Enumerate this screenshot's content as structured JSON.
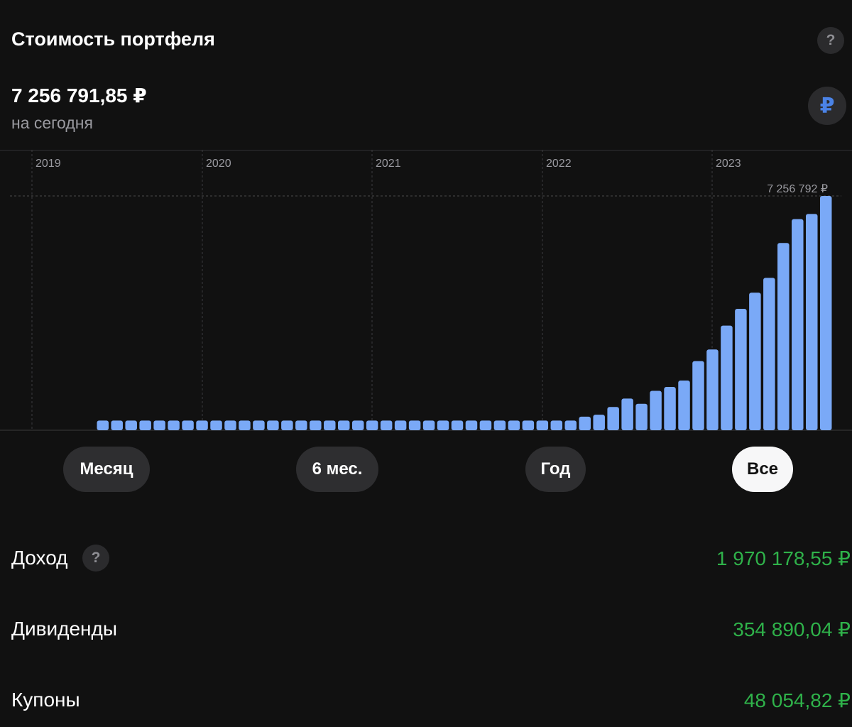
{
  "header": {
    "title": "Стоимость портфеля",
    "help_icon": "?"
  },
  "portfolio": {
    "value": "7 256 791,85  ₽",
    "subtitle": "на сегодня",
    "currency_icon": "₽"
  },
  "chart_data": {
    "type": "bar",
    "x_axis_labels": [
      "2019",
      "2020",
      "2021",
      "2022",
      "2023"
    ],
    "start_month": "2019-06",
    "end_month": "2023-09",
    "max_label": "7 256 792 ₽",
    "ylim": [
      0,
      7256792
    ],
    "bar_color": "#7aa9f7",
    "grid": true,
    "values": [
      300000,
      300000,
      300000,
      300000,
      300000,
      300000,
      300000,
      300000,
      300000,
      300000,
      300000,
      300000,
      300000,
      300000,
      300000,
      300000,
      300000,
      300000,
      300000,
      300000,
      300000,
      300000,
      300000,
      300000,
      300000,
      300000,
      300000,
      300000,
      300000,
      300000,
      300000,
      300000,
      300000,
      300000,
      420000,
      480000,
      720000,
      980000,
      820000,
      1220000,
      1340000,
      1540000,
      2140000,
      2500000,
      3240000,
      3760000,
      4260000,
      4720000,
      5800000,
      6540000,
      6700000,
      7256792
    ]
  },
  "periods": [
    {
      "label": "Месяц",
      "active": false
    },
    {
      "label": "6 мес.",
      "active": false
    },
    {
      "label": "Год",
      "active": false
    },
    {
      "label": "Все",
      "active": true
    }
  ],
  "stats": {
    "income_label": "Доход",
    "income_value": "1 970 178,55 ₽",
    "dividends_label": "Дивиденды",
    "dividends_value": "354 890,04 ₽",
    "coupons_label": "Купоны",
    "coupons_value": "48 054,82 ₽",
    "help_icon": "?"
  },
  "colors": {
    "background": "#111111",
    "bar": "#7aa9f7",
    "positive": "#2fb24a",
    "button": "#2e2e30",
    "button_active": "#f7f7f8"
  }
}
